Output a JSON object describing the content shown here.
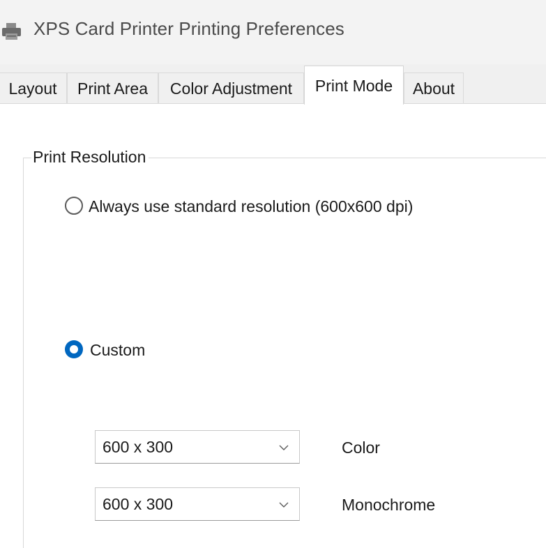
{
  "window": {
    "title": "XPS Card Printer Printing Preferences",
    "icon": "printer-icon"
  },
  "tabs": [
    {
      "label": "Layout",
      "active": false
    },
    {
      "label": "Print Area",
      "active": false
    },
    {
      "label": "Color Adjustment",
      "active": false
    },
    {
      "label": "Print Mode",
      "active": true
    },
    {
      "label": "About",
      "active": false
    }
  ],
  "print_resolution": {
    "group_title": "Print Resolution",
    "options": [
      {
        "label": "Always use standard resolution (600x600 dpi)",
        "selected": false
      },
      {
        "label": "Custom",
        "selected": true
      }
    ],
    "custom_settings": [
      {
        "value": "600 x 300",
        "label": "Color"
      },
      {
        "value": "600 x 300",
        "label": "Monochrome"
      }
    ]
  },
  "colors": {
    "accent": "#0067c0",
    "titlebar_bg": "#f3f3f3",
    "tabstrip_bg": "#f0f0f0"
  }
}
